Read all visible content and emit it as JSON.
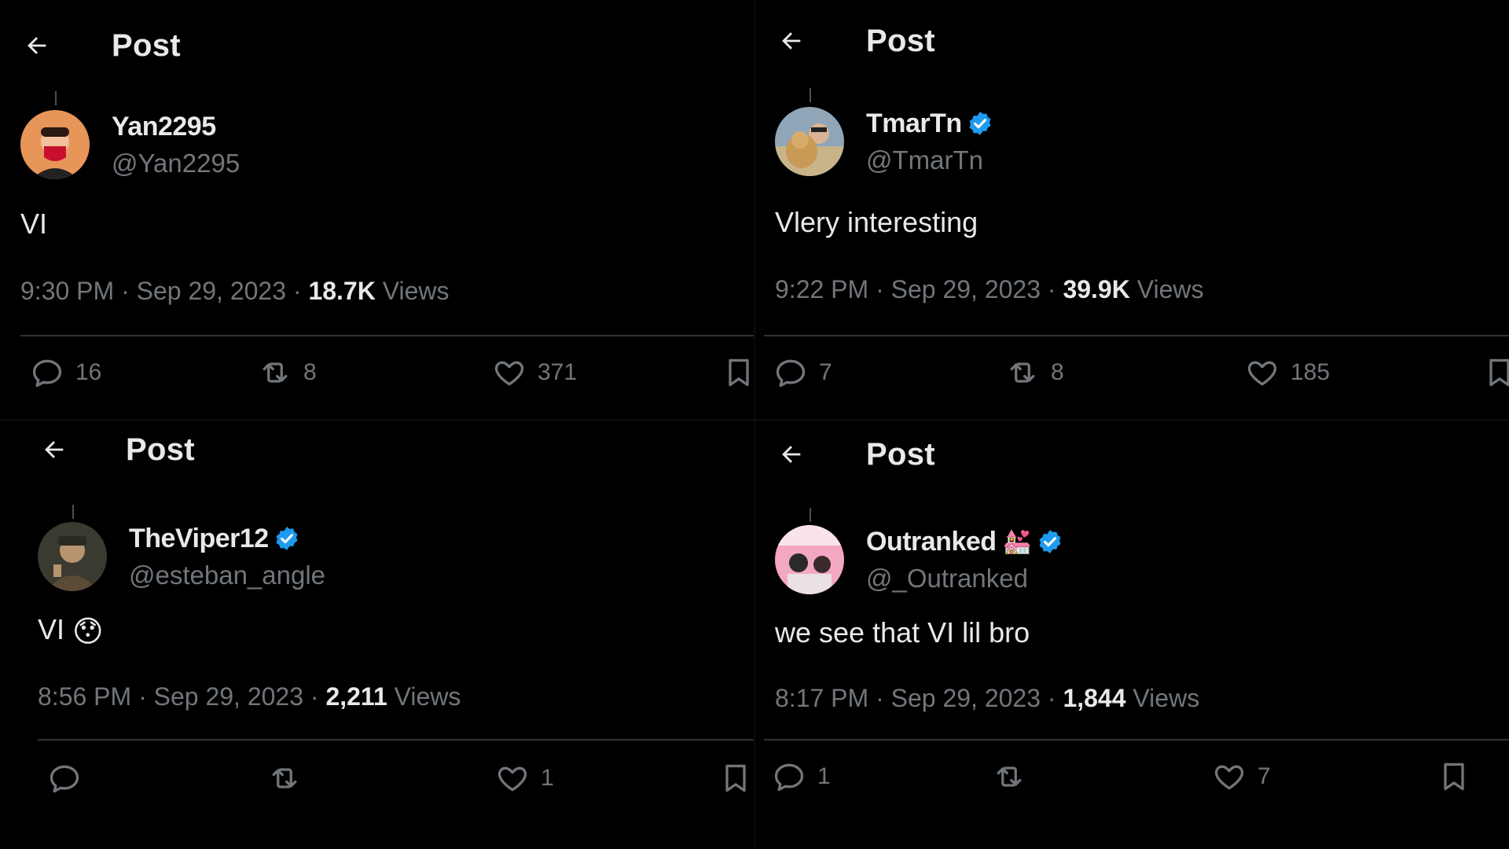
{
  "colors": {
    "background": "#000000",
    "text_primary": "#e7e9ea",
    "text_secondary": "#71767b",
    "divider": "#2f3336",
    "verified": "#1d9bf0"
  },
  "posts": [
    {
      "header_title": "Post",
      "display_name": "Yan2295",
      "handle": "@Yan2295",
      "verified": false,
      "text": "VI",
      "time": "9:30 PM · Sep 29, 2023 · ",
      "views_count": "18.7K",
      "views_label": " Views",
      "replies": "16",
      "reposts": "8",
      "likes": "371",
      "avatar_color": "#e8955a"
    },
    {
      "header_title": "Post",
      "display_name": "TmarTn",
      "handle": "@TmarTn",
      "verified": true,
      "text": "Vlery interesting",
      "time": "9:22 PM · Sep 29, 2023 · ",
      "views_count": "39.9K",
      "views_label": " Views",
      "replies": "7",
      "reposts": "8",
      "likes": "185",
      "avatar_color": "#8fa6b8"
    },
    {
      "header_title": "Post",
      "display_name": "TheViper12",
      "handle": "@esteban_angle",
      "verified": true,
      "text": "VI",
      "text_emoji": "😯",
      "time": "8:56 PM · Sep 29, 2023 · ",
      "views_count": "2,211",
      "views_label": " Views",
      "replies": "",
      "reposts": "",
      "likes": "1",
      "avatar_color": "#6b5a45"
    },
    {
      "header_title": "Post",
      "display_name": "Outranked",
      "name_emoji": "💒",
      "handle": "@_Outranked",
      "verified": true,
      "text": "we see that VI lil bro",
      "time": "8:17 PM · Sep 29, 2023 · ",
      "views_count": "1,844",
      "views_label": " Views",
      "replies": "1",
      "reposts": "",
      "likes": "7",
      "avatar_color": "#f2a7c3"
    }
  ]
}
